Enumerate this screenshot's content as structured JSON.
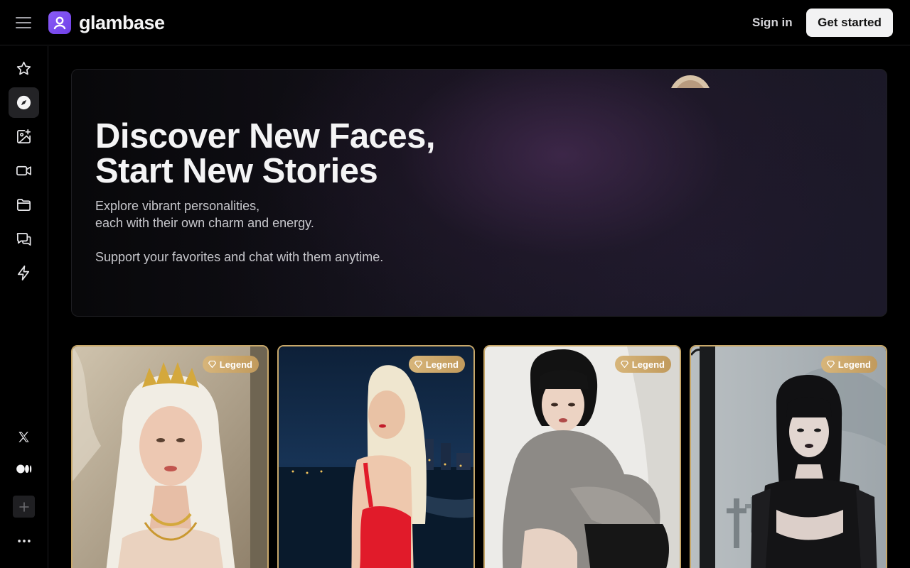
{
  "header": {
    "brand": "glambase",
    "sign_in": "Sign in",
    "get_started": "Get started"
  },
  "sidebar": {
    "items": [
      {
        "icon": "star-icon",
        "active": false
      },
      {
        "icon": "compass-icon",
        "active": true
      },
      {
        "icon": "image-sparkle-icon",
        "active": false
      },
      {
        "icon": "video-icon",
        "active": false
      },
      {
        "icon": "folder-icon",
        "active": false
      },
      {
        "icon": "chat-icon",
        "active": false
      },
      {
        "icon": "lightning-icon",
        "active": false
      }
    ],
    "social": [
      {
        "icon": "x-logo-icon"
      },
      {
        "icon": "medium-logo-icon"
      }
    ],
    "footer": [
      {
        "icon": "plus-icon"
      },
      {
        "icon": "more-dots-icon"
      }
    ]
  },
  "hero": {
    "title_line1": "Discover New Faces,",
    "title_line2": "Start New Stories",
    "subtitle_line1": "Explore vibrant personalities,",
    "subtitle_line2": "each with their own charm and energy.",
    "subtitle_line3": "Support your favorites and chat with them anytime."
  },
  "cards": [
    {
      "badge": "Legend"
    },
    {
      "badge": "Legend"
    },
    {
      "badge": "Legend"
    },
    {
      "badge": "Legend"
    }
  ],
  "colors": {
    "accent": "#7c4ff0",
    "badge_gold": "#c8a86a",
    "background": "#000000"
  }
}
